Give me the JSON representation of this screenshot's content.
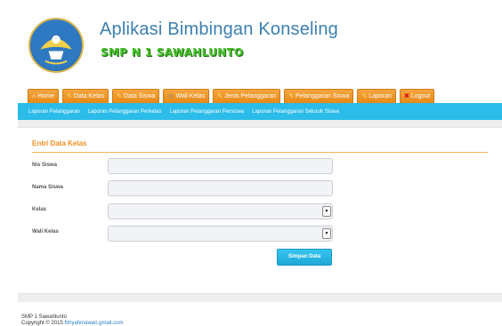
{
  "header": {
    "app_title": "Aplikasi Bimbingan Konseling",
    "school_name": "SMP N 1 SAWAHLUNTO"
  },
  "main_nav": [
    {
      "label": "Home",
      "icon": "home-icon"
    },
    {
      "label": "Data Kelas",
      "icon": "pencil-icon"
    },
    {
      "label": "Data Siswa",
      "icon": "pencil-icon"
    },
    {
      "label": "Wali Kelas",
      "icon": "user-icon"
    },
    {
      "label": "Jenis Pelanggaran",
      "icon": "pencil-icon"
    },
    {
      "label": "Pelanggaran Siswa",
      "icon": "pencil-icon"
    },
    {
      "label": "Laporan",
      "icon": "pencil-icon"
    },
    {
      "label": "Logout",
      "icon": "close-icon"
    }
  ],
  "sub_nav": [
    "Laporan Pelanggaran",
    "Laporan Pelanggaran Perkelas",
    "Laporan Pelanggaran Persiswa",
    "Laporan Pelanggaran Seluruh Siswa"
  ],
  "form": {
    "title": "Entri Data Kelas",
    "fields": [
      {
        "label": "Nis Siswa",
        "type": "text",
        "value": ""
      },
      {
        "label": "Nama Siswa",
        "type": "text",
        "value": ""
      },
      {
        "label": "Kelas",
        "type": "select",
        "value": ""
      },
      {
        "label": "Wali Kelas",
        "type": "select",
        "value": ""
      }
    ],
    "submit_label": "Simpan Data"
  },
  "footer": {
    "line1": "SMP 1 Sawahlunto",
    "line2_prefix": "Copyright © 2015 ",
    "line2_link": "fitriyahmawari.gmail.com"
  },
  "colors": {
    "nav_orange": "#e68a16",
    "subnav_blue": "#2bbce9",
    "title_orange": "#f28c1e",
    "school_green": "#46c02a",
    "app_title_blue": "#3b7fb1"
  }
}
